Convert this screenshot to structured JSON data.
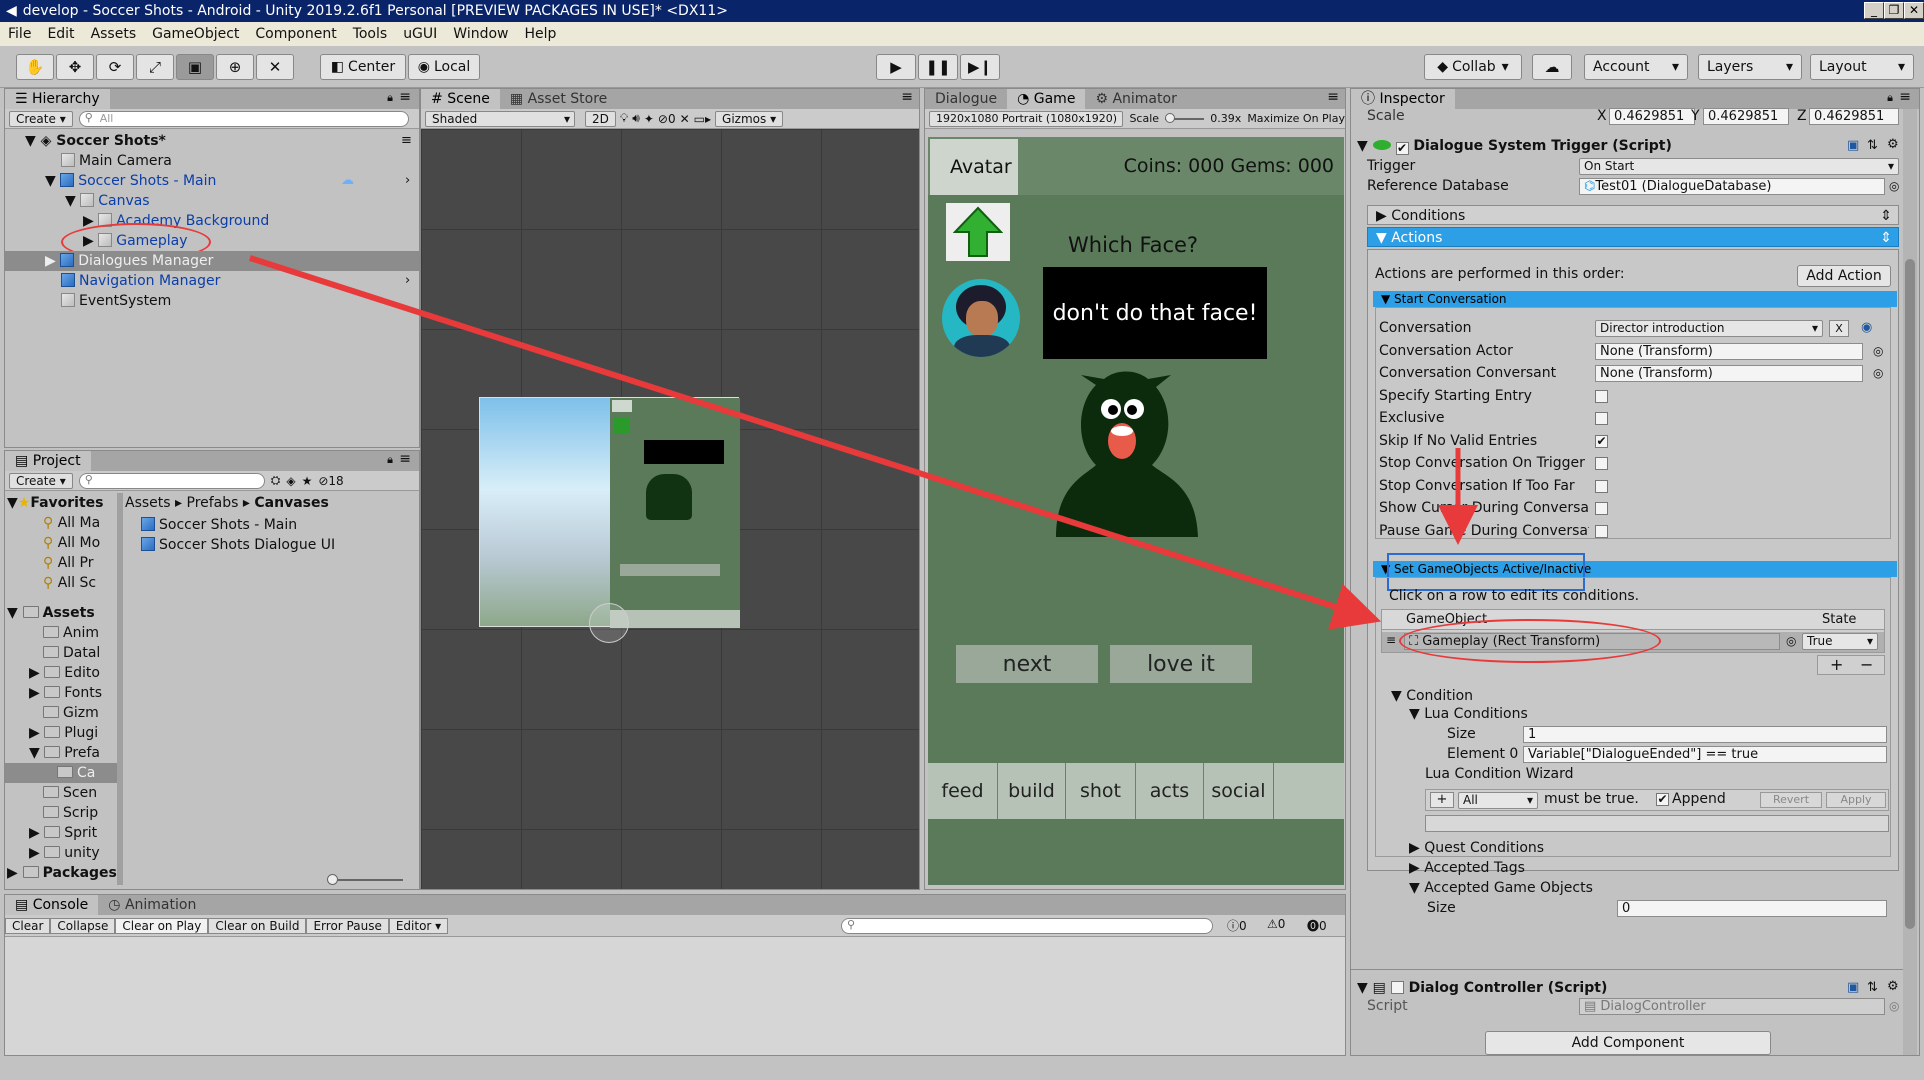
{
  "window": {
    "title": "develop - Soccer Shots - Android - Unity 2019.2.6f1 Personal [PREVIEW PACKAGES IN USE]* <DX11>"
  },
  "menu": [
    "File",
    "Edit",
    "Assets",
    "GameObject",
    "Component",
    "Tools",
    "uGUI",
    "Window",
    "Help"
  ],
  "toolbar": {
    "center": "Center",
    "local": "Local",
    "collab": "Collab",
    "account": "Account",
    "layers": "Layers",
    "layout": "Layout"
  },
  "hierarchy": {
    "tab": "Hierarchy",
    "create": "Create",
    "search": "All",
    "scene": "Soccer Shots*",
    "items": [
      "Main Camera",
      "Soccer Shots - Main",
      "Canvas",
      "Academy Background",
      "Gameplay",
      "Dialogues Manager",
      "Navigation Manager",
      "EventSystem"
    ]
  },
  "project": {
    "tab": "Project",
    "create": "Create",
    "count": "18",
    "favorites": "Favorites",
    "fav_items": [
      "All Ma",
      "All Mo",
      "All Pr",
      "All Sc"
    ],
    "assets": "Assets",
    "asset_folders": [
      "Anim",
      "Datal",
      "Edito",
      "Fonts",
      "Gizm",
      "Plugi",
      "Prefa",
      "Ca",
      "Scen",
      "Scrip",
      "Sprit",
      "unity"
    ],
    "packages": "Packages",
    "breadcrumb": [
      "Assets",
      "Prefabs",
      "Canvases"
    ],
    "files": [
      "Soccer Shots - Main",
      "Soccer Shots Dialogue UI"
    ]
  },
  "scene": {
    "tab": "Scene",
    "tab2": "Asset Store",
    "shading": "Shaded",
    "mode2d": "2D",
    "hidden": "0",
    "gizmos": "Gizmos"
  },
  "game": {
    "tab_dialogue": "Dialogue",
    "tab": "Game",
    "tab_animator": "Animator",
    "resolution": "1920x1080 Portrait (1080x1920)",
    "scale_label": "Scale",
    "scale": "0.39x",
    "maximize": "Maximize On Play",
    "avatar": "Avatar",
    "coins": "Coins: 000 Gems: 000",
    "question": "Which Face?",
    "speech": "don't do that face!",
    "btn_next": "next",
    "btn_love": "love it",
    "tabs": [
      "feed",
      "build",
      "shot",
      "acts",
      "social"
    ]
  },
  "inspector": {
    "tab": "Inspector",
    "scale_label": "Scale",
    "scale_x": "0.4629851",
    "scale_y": "0.4629851",
    "scale_z": "0.4629851",
    "component": "Dialogue System Trigger (Script)",
    "trigger_label": "Trigger",
    "trigger": "On Start",
    "refdb_label": "Reference Database",
    "refdb": "Test01 (DialogueDatabase)",
    "conditions": "Conditions",
    "actions": "Actions",
    "actions_note": "Actions are performed in this order:",
    "add_action": "Add Action",
    "start_conv": "Start Conversation",
    "conv_rows": [
      {
        "label": "Conversation",
        "value": "Director introduction"
      },
      {
        "label": "Conversation Actor",
        "value": "None (Transform)"
      },
      {
        "label": "Conversation Conversant",
        "value": "None (Transform)"
      }
    ],
    "checks": [
      {
        "label": "Specify Starting Entry",
        "checked": ""
      },
      {
        "label": "Exclusive",
        "checked": ""
      },
      {
        "label": "Skip If No Valid Entries",
        "checked": "✔"
      },
      {
        "label": "Stop Conversation On Trigger Exit",
        "checked": ""
      },
      {
        "label": "Stop Conversation If Too Far",
        "checked": ""
      },
      {
        "label": "Show Cursor During Conversation",
        "checked": ""
      },
      {
        "label": "Pause Game During Conversation",
        "checked": ""
      }
    ],
    "set_go": "Set GameObjects Active/Inactive",
    "click_note": "Click on a row to edit its conditions.",
    "col_go": "GameObject",
    "col_state": "State",
    "go_value": "Gameplay (Rect Transform)",
    "state": "True",
    "condition": "Condition",
    "lua_conditions": "Lua Conditions",
    "size_label": "Size",
    "size": "1",
    "element0_label": "Element 0",
    "element0": "Variable[\"DialogueEnded\"] == true",
    "lua_wizard": "Lua Condition Wizard",
    "wiz_all": "All",
    "wiz_must": "must be true.",
    "wiz_append": "Append",
    "revert": "Revert",
    "apply": "Apply",
    "quest_conditions": "Quest Conditions",
    "accepted_tags": "Accepted Tags",
    "accepted_go": "Accepted Game Objects",
    "size2": "0",
    "dialog_ctrl": "Dialog Controller (Script)",
    "script_label": "Script",
    "script": "DialogController",
    "add_component": "Add Component"
  },
  "console": {
    "tab": "Console",
    "tab2": "Animation",
    "buttons": [
      "Clear",
      "Collapse",
      "Clear on Play",
      "Clear on Build",
      "Error Pause",
      "Editor"
    ],
    "counts": [
      "0",
      "0",
      "0"
    ]
  },
  "colors": {
    "arrow": "#e83a3a",
    "blue": "#2c9fe6",
    "game_bg": "#5a7a5a"
  }
}
